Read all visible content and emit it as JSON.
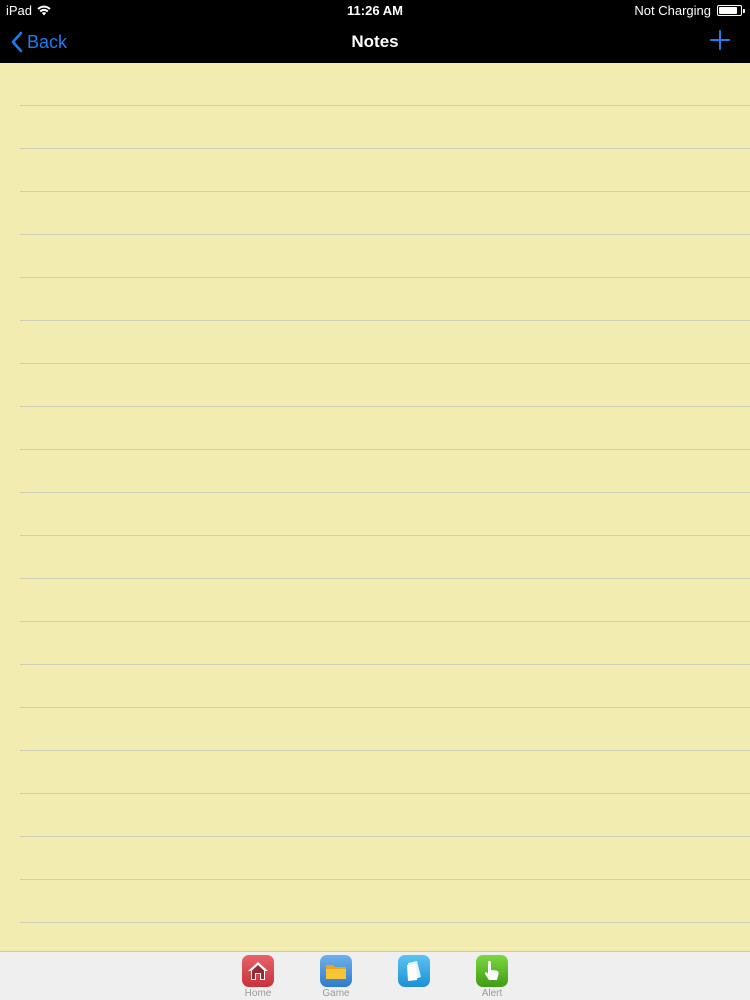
{
  "status_bar": {
    "device": "iPad",
    "time": "11:26 AM",
    "battery_status": "Not Charging",
    "battery_level": 0.85
  },
  "nav_bar": {
    "back_label": "Back",
    "title": "Notes"
  },
  "tab_bar": {
    "items": [
      {
        "label": "Home",
        "icon": "home-icon",
        "color": "#d9434b"
      },
      {
        "label": "Game",
        "icon": "folder-icon",
        "color": "#3f8fd6"
      },
      {
        "label": "",
        "icon": "notes-icon",
        "color": "#2ea5e6"
      },
      {
        "label": "Alert",
        "icon": "hand-pointer-icon",
        "color": "#4fb51f"
      }
    ]
  },
  "colors": {
    "accent": "#1e7cf0",
    "paper": "#f3ecb1",
    "rule": "#cfcfb8"
  }
}
